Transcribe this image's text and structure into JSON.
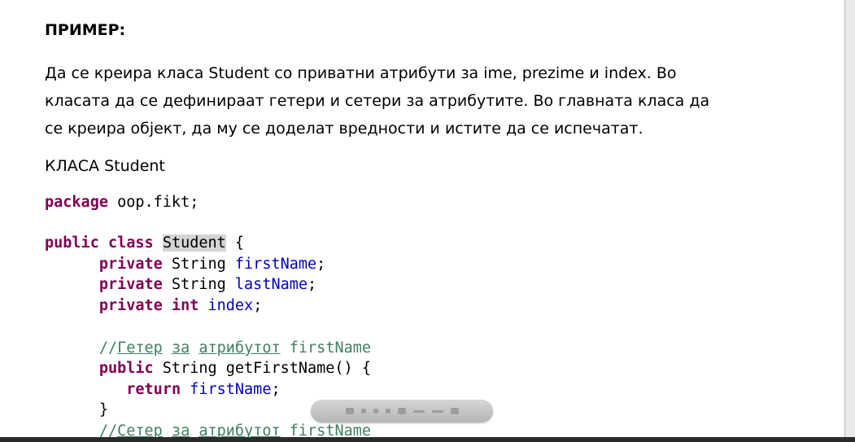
{
  "heading": "ПРИМЕР:",
  "paragraph": [
    "Да се креира класа Student со приватни атрибути за ime, prezime и index. Во",
    "класата да се дефинираат гетери и сетери за атрибутите. Во главната класа да",
    "се креира објект, да му се доделат вредности и истите да се испечатат."
  ],
  "subheading": "КЛАСА Student",
  "code": {
    "package_kw": "package",
    "package_name": " oop.fikt;",
    "public_kw": "public",
    "class_kw": "class",
    "class_name": "Student",
    "open_brace": " {",
    "private_kw": "private",
    "string_type": " String ",
    "int_type": "int",
    "field_first": "firstName",
    "field_last": "lastName",
    "field_index": "index",
    "semicolon": ";",
    "comment_slashes": "//",
    "comment_getter": "Гетер",
    "comment_za": "за",
    "comment_attr": "атрибутот",
    "comment_field": " firstName",
    "comment_setter": "Сетер",
    "getter_sig": " String getFirstName() {",
    "return_kw": "return",
    "close_brace": "}"
  },
  "toolbar": {
    "icons": [
      "first-page-icon",
      "prev-icon",
      "page-icon",
      "zoom-out-icon",
      "zoom-icon",
      "zoom-in-icon",
      "fit-icon",
      "collapse-icon"
    ]
  }
}
